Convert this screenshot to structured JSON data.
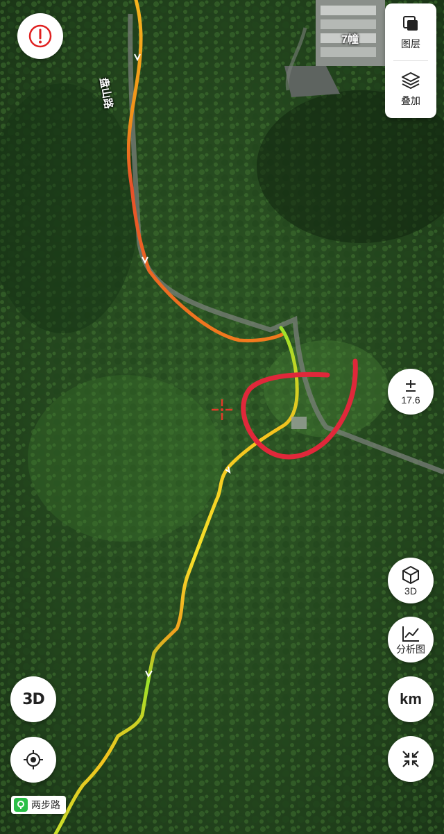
{
  "map": {
    "poi_label": "7幢",
    "road_label": "盘山路"
  },
  "controls": {
    "layers_label": "图层",
    "overlay_label": "叠加",
    "zoom_level": "17.6",
    "view_3d_label": "3D",
    "analysis_label": "分析图",
    "units_label": "km",
    "terrain_3d_icon_text": "3D"
  },
  "brand": {
    "name": "两步路"
  },
  "colors": {
    "track_start": "#f5e12a",
    "track_mid": "#f59a1e",
    "track_end": "#e8401c",
    "annotation": "#e0283a",
    "alert": "#e02020"
  }
}
